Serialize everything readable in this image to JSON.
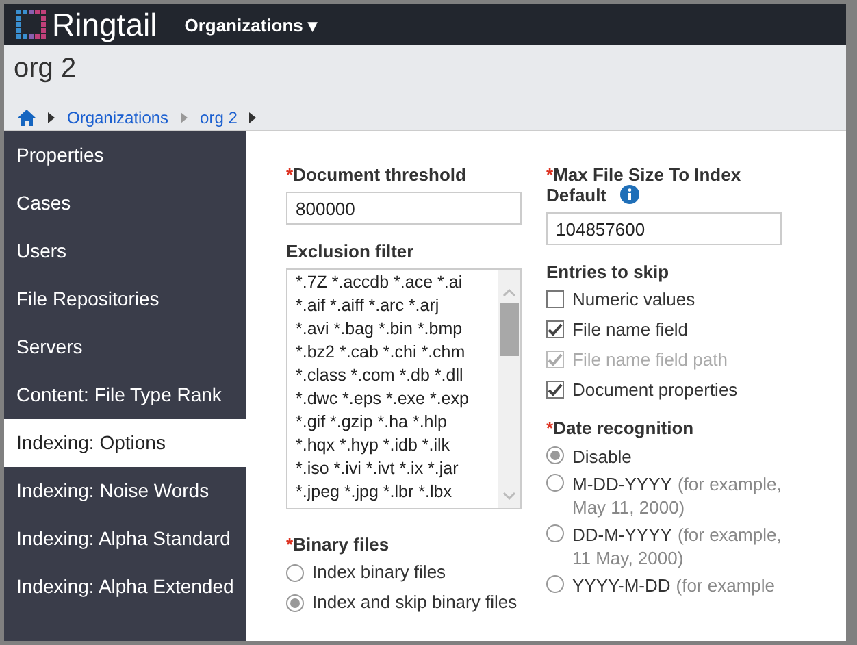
{
  "header": {
    "logo": "Ringtail",
    "menu": "Organizations ▾"
  },
  "page_title": "org 2",
  "breadcrumb": [
    "Organizations",
    "org 2"
  ],
  "sidebar": {
    "items": [
      {
        "label": "Properties",
        "selected": false
      },
      {
        "label": "Cases",
        "selected": false
      },
      {
        "label": "Users",
        "selected": false
      },
      {
        "label": "File Repositories",
        "selected": false
      },
      {
        "label": "Servers",
        "selected": false
      },
      {
        "label": "Content: File Type Rank",
        "selected": false
      },
      {
        "label": "Indexing: Options",
        "selected": true
      },
      {
        "label": "Indexing: Noise Words",
        "selected": false
      },
      {
        "label": "Indexing: Alpha Standard",
        "selected": false
      },
      {
        "label": "Indexing: Alpha Extended",
        "selected": false
      }
    ]
  },
  "document_threshold": {
    "required_mark": "*",
    "label": "Document threshold",
    "value": "800000"
  },
  "exclusion_filter": {
    "label": "Exclusion filter",
    "lines": [
      "*.7Z *.accdb *.ace *.ai",
      "*.aif *.aiff *.arc *.arj",
      "*.avi *.bag *.bin *.bmp",
      "*.bz2 *.cab *.chi *.chm",
      "*.class *.com *.db *.dll",
      "*.dwc *.eps *.exe *.exp",
      "*.gif *.gzip *.ha *.hlp",
      "*.hqx *.hyp *.idb *.ilk",
      "*.iso *.ivi *.ivt *.ix *.jar",
      "*.jpeg *.jpg *.lbr *.lbx"
    ]
  },
  "binary_files": {
    "required_mark": "*",
    "label": "Binary files",
    "options": [
      {
        "label": "Index binary files",
        "selected": false
      },
      {
        "label": "Index and skip binary files",
        "selected": true
      }
    ]
  },
  "max_file_size": {
    "required_mark": "*",
    "label": "Max File Size To Index Default",
    "value": "104857600"
  },
  "entries_to_skip": {
    "label": "Entries to skip",
    "options": [
      {
        "label": "Numeric values",
        "checked": false,
        "disabled": false
      },
      {
        "label": "File name field",
        "checked": true,
        "disabled": false
      },
      {
        "label": "File name field path",
        "checked": true,
        "disabled": true
      },
      {
        "label": "Document properties",
        "checked": true,
        "disabled": false
      }
    ]
  },
  "date_recognition": {
    "required_mark": "*",
    "label": "Date recognition",
    "options": [
      {
        "label": "Disable",
        "selected": true
      },
      {
        "label": "M-DD-YYYY",
        "hint": "(for example, May 11, 2000)",
        "selected": false
      },
      {
        "label": "DD-M-YYYY",
        "hint": "(for example, 11 May, 2000)",
        "selected": false
      },
      {
        "label": "YYYY-M-DD",
        "hint": "(for example",
        "selected": false
      }
    ]
  }
}
